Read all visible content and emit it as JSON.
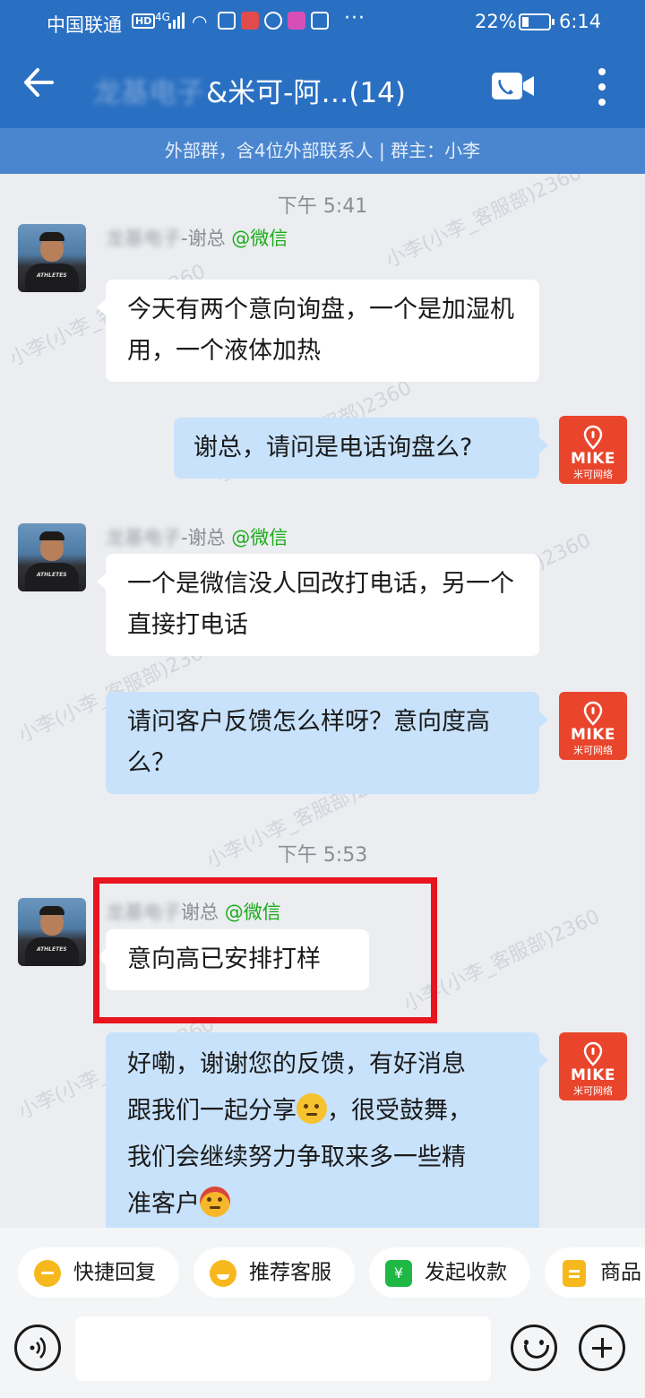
{
  "status_bar": {
    "carrier": "中国联通",
    "hd_badge": "HD",
    "network": "4G",
    "more": "···",
    "battery": "22%",
    "time": "6:14"
  },
  "header": {
    "title_blurred": "龙基电子",
    "title": "&米可-阿…(14)",
    "subtitle": "外部群，含4位外部联系人 | 群主：小李"
  },
  "watermark_text": "小李(小李_客服部)2360",
  "messages": [
    {
      "type": "time",
      "text": "下午 5:41"
    },
    {
      "type": "incoming",
      "sender_blurred": "龙基电子",
      "sender_suffix": "-谢总",
      "sender_tag": "@微信",
      "text": "今天有两个意向询盘，一个是加湿机用，一个液体加热"
    },
    {
      "type": "outgoing",
      "text": "谢总，请问是电话询盘么?"
    },
    {
      "type": "incoming",
      "sender_blurred": "龙基电子",
      "sender_suffix": "-谢总",
      "sender_tag": "@微信",
      "text": "一个是微信没人回改打电话，另一个直接打电话"
    },
    {
      "type": "outgoing",
      "text": "请问客户反馈怎么样呀？意向度高么？"
    },
    {
      "type": "time",
      "text": "下午 5:53"
    },
    {
      "type": "incoming",
      "sender_blurred": "龙基电子",
      "sender_suffix": "谢总",
      "sender_tag": "@微信",
      "text": "意向高已安排打样"
    },
    {
      "type": "outgoing",
      "line1": "好嘞，谢谢您的反馈，有好消息",
      "line2a": "跟我们一起分享",
      "line2b": "，很受鼓舞，",
      "line3": "我们会继续努力争取来多一些精",
      "line4": "准客户"
    }
  ],
  "logo": {
    "brand": "MIKE",
    "sub": "米可网络"
  },
  "quick_actions": [
    {
      "label": "快捷回复"
    },
    {
      "label": "推荐客服"
    },
    {
      "label": "发起收款",
      "icon_text": "¥"
    },
    {
      "label": "商品"
    }
  ],
  "input": {
    "placeholder": ""
  },
  "colors": {
    "header": "#2a70c2",
    "subbar": "#4a86cf",
    "outgoing": "#c8e2fb",
    "incoming": "#ffffff",
    "highlight": "#e8141e",
    "wechat": "#1aad19"
  }
}
